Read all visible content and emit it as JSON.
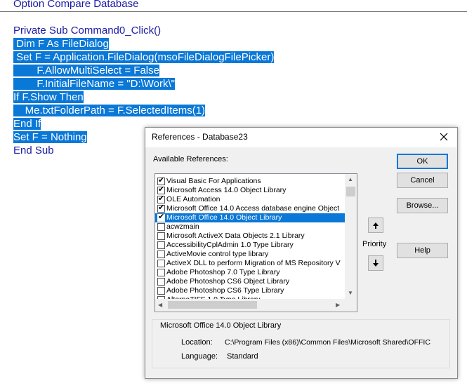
{
  "editor": {
    "declarations": "Option Compare Database",
    "lines": [
      {
        "text": "Private Sub Command0_Click()",
        "selected": false
      },
      {
        "text": " Dim F As FileDialog",
        "selected": true
      },
      {
        "text": " Set F = Application.FileDialog(msoFileDialogFilePicker)",
        "selected": true
      },
      {
        "text": "        F.AllowMultiSelect = False",
        "selected": true
      },
      {
        "text": "        F.InitialFileName = \"D:\\Work\\\"",
        "selected": true
      },
      {
        "text": "If F.Show Then",
        "selected": true
      },
      {
        "text": "    Me.txtFolderPath = F.SelectedItems(1)",
        "selected": true
      },
      {
        "text": "End If",
        "selected": true
      },
      {
        "text": "Set F = Nothing",
        "selected": true
      },
      {
        "text": "End Sub",
        "selected": false
      }
    ]
  },
  "dialog": {
    "title": "References - Database23",
    "available_label": "Available References:",
    "references": [
      {
        "label": "Visual Basic For Applications",
        "checked": true,
        "selected": false
      },
      {
        "label": "Microsoft Access 14.0 Object Library",
        "checked": true,
        "selected": false
      },
      {
        "label": "OLE Automation",
        "checked": true,
        "selected": false
      },
      {
        "label": "Microsoft Office 14.0 Access database engine Object",
        "checked": true,
        "selected": false
      },
      {
        "label": "Microsoft Office 14.0 Object Library",
        "checked": true,
        "selected": true
      },
      {
        "label": "acwzmain",
        "checked": false,
        "selected": false
      },
      {
        "label": "Microsoft ActiveX Data Objects 2.1 Library",
        "checked": false,
        "selected": false
      },
      {
        "label": "AccessibilityCplAdmin 1.0 Type Library",
        "checked": false,
        "selected": false
      },
      {
        "label": "ActiveMovie control type library",
        "checked": false,
        "selected": false
      },
      {
        "label": "ActiveX DLL to perform Migration of MS Repository V",
        "checked": false,
        "selected": false
      },
      {
        "label": "Adobe Photoshop 7.0 Type Library",
        "checked": false,
        "selected": false
      },
      {
        "label": "Adobe Photoshop CS6 Object Library",
        "checked": false,
        "selected": false
      },
      {
        "label": "Adobe Photoshop CS6 Type Library",
        "checked": false,
        "selected": false
      },
      {
        "label": "AlternaTIFF 1.0 Type Library",
        "checked": false,
        "selected": false
      }
    ],
    "buttons": {
      "ok": "OK",
      "cancel": "Cancel",
      "browse": "Browse...",
      "help": "Help"
    },
    "priority_label": "Priority",
    "info": {
      "name": "Microsoft Office 14.0 Object Library",
      "location_label": "Location:",
      "location_value": "C:\\Program Files (x86)\\Common Files\\Microsoft Shared\\OFFIC",
      "language_label": "Language:",
      "language_value": "Standard"
    },
    "colors": {
      "selection": "#0a78d7",
      "code_text": "#1a1aa6",
      "dialog_bg": "#f0f0f0"
    }
  }
}
